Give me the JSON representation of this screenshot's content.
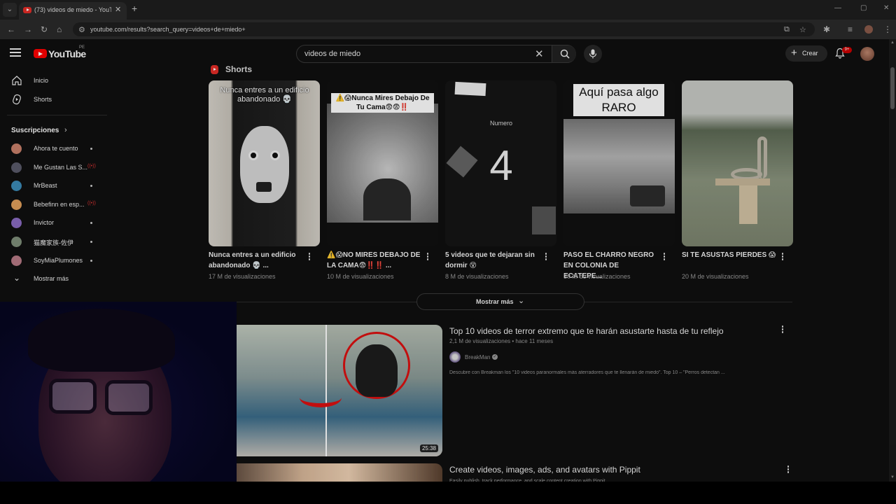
{
  "browser": {
    "tab_title": "(73) videos de miedo - YouTube",
    "tab_close": "✕",
    "new_tab": "+",
    "url": "youtube.com/results?search_query=videos+de+miedo+"
  },
  "masthead": {
    "logo_text": "YouTube",
    "country_code": "PE",
    "search_value": "videos de miedo",
    "create_label": "Crear",
    "notification_count": "9+"
  },
  "sidebar": {
    "items": [
      {
        "label": "Inicio",
        "icon": "home-icon"
      },
      {
        "label": "Shorts",
        "icon": "shorts-icon"
      }
    ],
    "subscriptions_heading": "Suscripciones",
    "subscriptions": [
      {
        "label": "Ahora te cuento",
        "status": "dot",
        "color": "#c9806a"
      },
      {
        "label": "Me Gustan Las S...",
        "status": "live",
        "color": "#5a5a6a"
      },
      {
        "label": "MrBeast",
        "status": "dot",
        "color": "#3c8bb8"
      },
      {
        "label": "Bebefinn en esp...",
        "status": "live",
        "color": "#e2a05c"
      },
      {
        "label": "Invictor",
        "status": "dot",
        "color": "#8a6bc2"
      },
      {
        "label": "猫魔家族-佐伊",
        "status": "dot",
        "color": "#7f8f7a"
      },
      {
        "label": "SoyMiaPlumones",
        "status": "dot",
        "color": "#b77a86"
      }
    ],
    "show_more": "Mostrar más"
  },
  "shorts": {
    "section_title": "Shorts",
    "items": [
      {
        "title": "Nunca entres a un edificio abandonado 💀 ...",
        "views": "17 M de visualizaciones",
        "overlay": "Nunca entres a un edificio abandonado 💀"
      },
      {
        "title": "⚠️😱NO MIRES DEBAJO DE LA CAMA😨‼️‼️ ...",
        "views": "10 M de visualizaciones",
        "overlay": "⚠️😱Nunca Mires Debajo De Tu Cama😨😨‼️"
      },
      {
        "title": "5 videos que te dejaran sin dormir 😵",
        "views": "8 M de visualizaciones",
        "overlay": "Numero",
        "overlay_big": "4"
      },
      {
        "title": "PASO EL CHARRO NEGRO EN COLONIA DE ECATEPE...",
        "views": "30 M de visualizaciones",
        "overlay": "Aquí pasa algo RARO"
      },
      {
        "title": "SI TE ASUSTAS PIERDES 😱",
        "views": "20 M de visualizaciones",
        "overlay": ""
      }
    ],
    "show_more": "Mostrar más"
  },
  "results": [
    {
      "title": "Top 10 videos de terror extremo que te harán asustarte hasta de tu reflejo",
      "meta": "2,1 M de visualizaciones • hace 11 meses",
      "channel": "BreakMan",
      "description": "Descubre con Breakman los \"10 videos paranormales más aterradores que te llenarán de miedo\". Top 10 – \"Perros detectan ...",
      "duration": "25:38"
    },
    {
      "title": "Create videos, images, ads, and avatars with Pippit",
      "meta": "Easily publish, track performance, and scale content creation with Pippit."
    }
  ]
}
